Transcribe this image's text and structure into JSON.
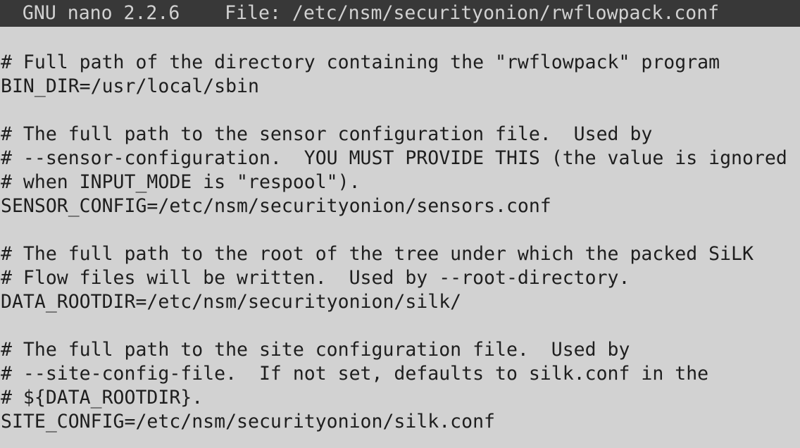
{
  "title_bar": {
    "app_name": "GNU nano 2.2.6",
    "file_label": "File:",
    "file_path": "/etc/nsm/securityonion/rwflowpack.conf"
  },
  "colors": {
    "background": "#d2d2d2",
    "title_bar_background": "#383838",
    "title_bar_text": "#d2d2d2",
    "text": "#1e1e1e"
  },
  "buffer_lines": [
    "# Full path of the directory containing the \"rwflowpack\" program",
    "BIN_DIR=/usr/local/sbin",
    "",
    "# The full path to the sensor configuration file.  Used by",
    "# --sensor-configuration.  YOU MUST PROVIDE THIS (the value is ignored",
    "# when INPUT_MODE is \"respool\").",
    "SENSOR_CONFIG=/etc/nsm/securityonion/sensors.conf",
    "",
    "# The full path to the root of the tree under which the packed SiLK",
    "# Flow files will be written.  Used by --root-directory.",
    "DATA_ROOTDIR=/etc/nsm/securityonion/silk/",
    "",
    "# The full path to the site configuration file.  Used by",
    "# --site-config-file.  If not set, defaults to silk.conf in the",
    "# ${DATA_ROOTDIR}.",
    "SITE_CONFIG=/etc/nsm/securityonion/silk.conf"
  ]
}
